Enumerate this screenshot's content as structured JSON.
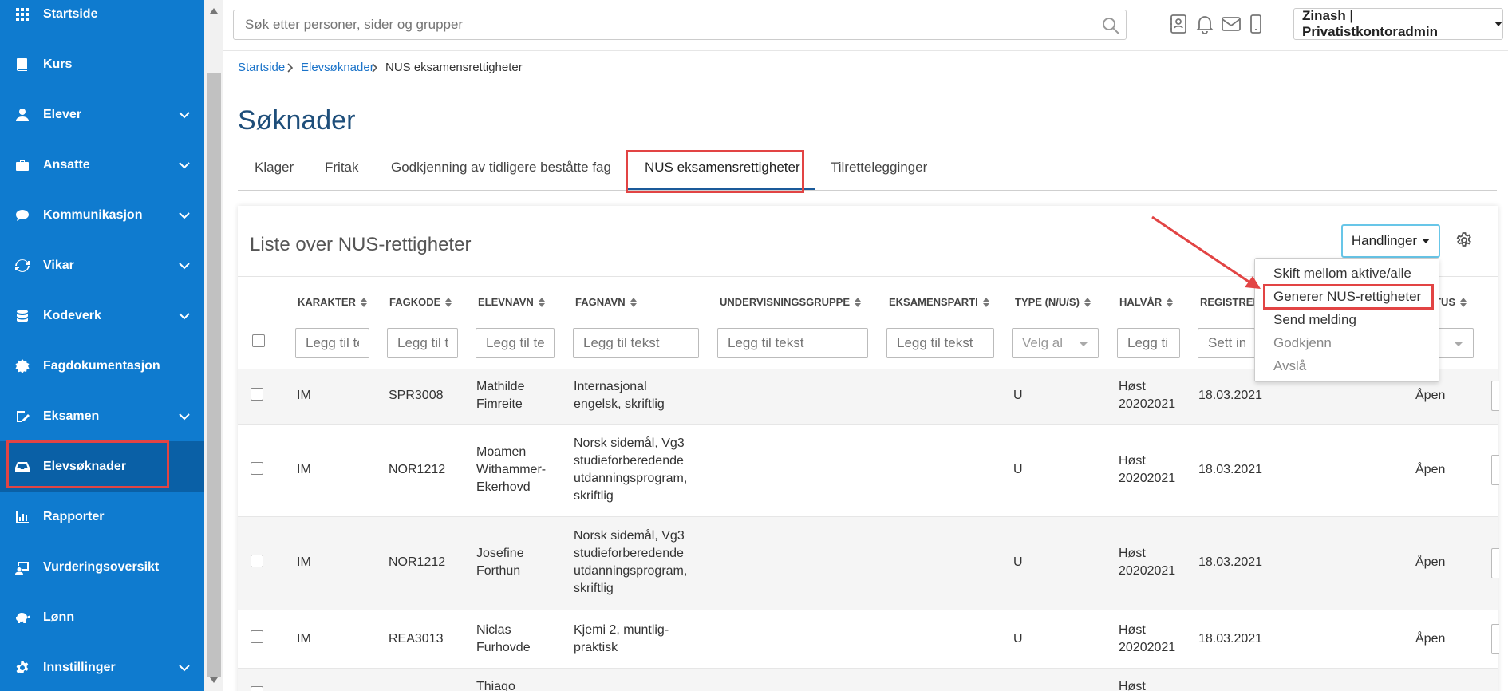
{
  "sidebar": {
    "items": [
      {
        "label": "Startside",
        "icon": "grid-icon",
        "chevron": false
      },
      {
        "label": "Kurs",
        "icon": "book-icon",
        "chevron": false
      },
      {
        "label": "Elever",
        "icon": "students-icon",
        "chevron": true
      },
      {
        "label": "Ansatte",
        "icon": "briefcase-icon",
        "chevron": true
      },
      {
        "label": "Kommunikasjon",
        "icon": "chat-icon",
        "chevron": true
      },
      {
        "label": "Vikar",
        "icon": "refresh-icon",
        "chevron": true
      },
      {
        "label": "Kodeverk",
        "icon": "database-icon",
        "chevron": true
      },
      {
        "label": "Fagdokumentasjon",
        "icon": "badge-icon",
        "chevron": false
      },
      {
        "label": "Eksamen",
        "icon": "exam-icon",
        "chevron": true
      },
      {
        "label": "Elevsøknader",
        "icon": "inbox-icon",
        "chevron": false,
        "active": true
      },
      {
        "label": "Rapporter",
        "icon": "bar-chart-icon",
        "chevron": false
      },
      {
        "label": "Vurderingsoversikt",
        "icon": "assessment-icon",
        "chevron": false
      },
      {
        "label": "Lønn",
        "icon": "piggy-bank-icon",
        "chevron": false
      },
      {
        "label": "Innstillinger",
        "icon": "settings-icon",
        "chevron": true
      }
    ]
  },
  "topbar": {
    "search_placeholder": "Søk etter personer, sider og grupper",
    "user": "Zinash | Privatistkontoradmin"
  },
  "breadcrumb": {
    "home": "Startside",
    "section": "Elevsøknader",
    "current": "NUS eksamensrettigheter"
  },
  "page": {
    "title": "Søknader",
    "tabs": [
      "Klager",
      "Fritak",
      "Godkjenning av tidligere beståtte fag",
      "NUS eksamensrettigheter",
      "Tilrettelegginger"
    ],
    "active_tab": "NUS eksamensrettigheter"
  },
  "list": {
    "title": "Liste over NUS-rettigheter",
    "actions_label": "Handlinger",
    "actions_menu": [
      "Skift mellom aktive/alle",
      "Generer NUS-rettigheter",
      "Send melding",
      "Godkjenn",
      "Avslå"
    ],
    "columns": [
      "KARAKTER",
      "FAGKODE",
      "ELEVNAVN",
      "FAGNAVN",
      "UNDERVISNINGSGRUPPE",
      "EKSAMENSPARTI",
      "TYPE (N/U/S)",
      "HALVÅR",
      "REGISTRER",
      "TUS"
    ],
    "filters": {
      "karakter": "Legg til te",
      "fagkode": "Legg til t",
      "elevnavn": "Legg til te",
      "fagnavn": "Legg til tekst",
      "undervisningsgruppe": "Legg til tekst",
      "eksamensparti": "Legg til tekst",
      "type": "Velg al",
      "halvar": "Legg ti",
      "registrert": "Sett inn"
    },
    "rows": [
      {
        "karakter": "IM",
        "fagkode": "SPR3008",
        "elevnavn": [
          "Mathilde",
          "Fimreite"
        ],
        "fagnavn": [
          "Internasjonal",
          "engelsk, skriftlig"
        ],
        "type": "U",
        "halvar": [
          "Høst",
          "20202021"
        ],
        "dato": "18.03.2021",
        "status": "Åpen"
      },
      {
        "karakter": "IM",
        "fagkode": "NOR1212",
        "elevnavn": [
          "Moamen",
          "Withammer-",
          "Ekerhovd"
        ],
        "fagnavn": [
          "Norsk sidemål, Vg3",
          "studieforberedende",
          "utdanningsprogram,",
          "skriftlig"
        ],
        "type": "U",
        "halvar": [
          "Høst",
          "20202021"
        ],
        "dato": "18.03.2021",
        "status": "Åpen"
      },
      {
        "karakter": "IM",
        "fagkode": "NOR1212",
        "elevnavn": [
          "Josefine",
          "Forthun"
        ],
        "fagnavn": [
          "Norsk sidemål, Vg3",
          "studieforberedende",
          "utdanningsprogram,",
          "skriftlig"
        ],
        "type": "U",
        "halvar": [
          "Høst",
          "20202021"
        ],
        "dato": "18.03.2021",
        "status": "Åpen"
      },
      {
        "karakter": "IM",
        "fagkode": "REA3013",
        "elevnavn": [
          "Niclas",
          "Furhovde"
        ],
        "fagnavn": [
          "Kjemi 2, muntlig-",
          "praktisk"
        ],
        "type": "U",
        "halvar": [
          "Høst",
          "20202021"
        ],
        "dato": "18.03.2021",
        "status": "Åpen"
      },
      {
        "elevnavn": [
          "Thiago"
        ],
        "halvar": [
          "Høst"
        ]
      }
    ]
  },
  "colors": {
    "sidebar": "#0f7bcf",
    "sidebar_active": "#0a60a6",
    "highlight": "#e24444",
    "link": "#1a73c9"
  }
}
